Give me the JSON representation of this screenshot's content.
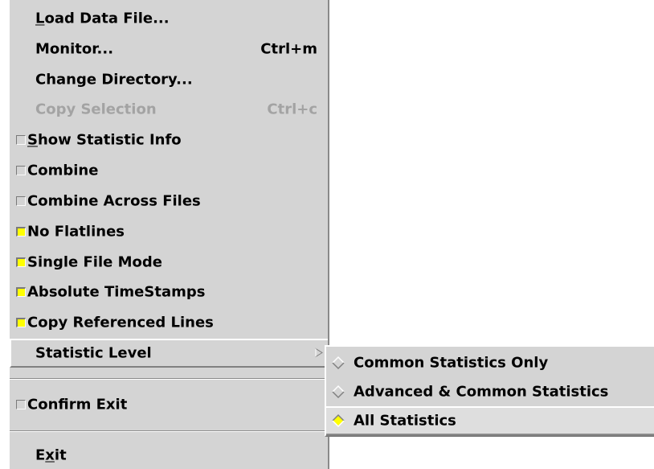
{
  "menu": {
    "load_data_file": {
      "label_pre": "",
      "mnemonic": "L",
      "label_post": "oad Data File..."
    },
    "monitor": {
      "label": "Monitor...",
      "accel": "Ctrl+m"
    },
    "change_directory": {
      "label": "Change Directory..."
    },
    "copy_selection": {
      "label": "Copy Selection",
      "accel": "Ctrl+c",
      "enabled": false
    },
    "show_statistic_info": {
      "mnemonic": "S",
      "label_post": "how Statistic Info",
      "checked": false
    },
    "combine": {
      "label": "Combine",
      "checked": false
    },
    "combine_across_files": {
      "label": "Combine Across Files",
      "checked": false
    },
    "no_flatlines": {
      "label": "No Flatlines",
      "checked": true
    },
    "single_file_mode": {
      "label": "Single File Mode",
      "checked": true
    },
    "absolute_timestamps": {
      "label": "Absolute TimeStamps",
      "checked": true
    },
    "copy_referenced_lines": {
      "label": "Copy Referenced Lines",
      "checked": true
    },
    "statistic_level": {
      "label": "Statistic Level"
    },
    "confirm_exit": {
      "label": "Confirm Exit",
      "checked": false
    },
    "exit": {
      "label_pre": "E",
      "mnemonic": "x",
      "label_post": "it"
    }
  },
  "submenu": {
    "items": [
      {
        "label": "Common Statistics Only",
        "selected": false
      },
      {
        "label": "Advanced & Common Statistics",
        "selected": false
      },
      {
        "label": "All Statistics",
        "selected": true
      }
    ]
  },
  "colors": {
    "menu_bg": "#d4d4d4",
    "check_on": "#ffff00",
    "disabled_text": "#a3a3a3"
  }
}
